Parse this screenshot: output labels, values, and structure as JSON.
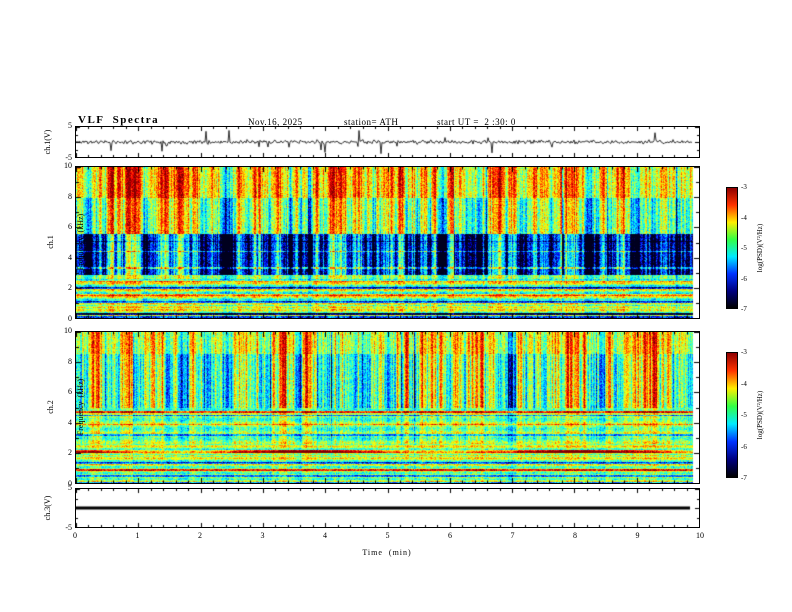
{
  "figure": {
    "title": "VLF  Spectra",
    "date": "Nov.16, 2025",
    "station_label": "station= ATH",
    "start_ut_label": "start UT =  2 :30: 0"
  },
  "axes": {
    "x_title": "Time  (min)",
    "x_ticks": [
      "0",
      "1",
      "2",
      "3",
      "4",
      "5",
      "6",
      "7",
      "8",
      "9",
      "10"
    ],
    "freq_ticks": [
      "10",
      "8",
      "6",
      "4",
      "2",
      "0"
    ],
    "volt_ticks": [
      "5",
      "-5"
    ],
    "ch1v_label": "ch.1(V)",
    "ch1_label_line1": "ch.1",
    "ch1_label_line2": "Frequency  (kHz)",
    "ch2_label_line1": "ch.2",
    "ch2_label_line2": "Frequency  (kHz)",
    "ch3v_label": "ch.3(V)"
  },
  "colorbar": {
    "ticks": [
      "-3",
      "-4",
      "-5",
      "-6",
      "-7"
    ],
    "label": "log(PSD)(V²/Hz)",
    "value_range": [
      -7,
      -3
    ],
    "colors_top_to_bottom": [
      "#8f0000",
      "#ff3300",
      "#ffee00",
      "#33ff44",
      "#00eaff",
      "#0033ff",
      "#000080",
      "#000000"
    ]
  },
  "chart_data": [
    {
      "type": "line",
      "name": "ch1-voltage-waveform",
      "ylabel": "ch.1(V)",
      "ylim": [
        -5,
        5
      ],
      "xlim": [
        0,
        10
      ],
      "xlabel": "Time (min)",
      "data_end_min": 9.9,
      "baseline_v": 0,
      "noise_amp_v": 0.45,
      "spike_probability": 0.03,
      "spike_max_v": 4.6,
      "seed": 11
    },
    {
      "type": "heatmap",
      "name": "ch1-spectrogram",
      "ylabel": "ch.1 Frequency (kHz)",
      "ylim": [
        0,
        10
      ],
      "xlim": [
        0,
        10
      ],
      "value_range": [
        -7,
        -3
      ],
      "units": "log(PSD)(V²/Hz)",
      "colormap": "jet-black-low",
      "seed": 7,
      "base_level": -5.05,
      "noise": 0.9,
      "data_end_min": 9.9,
      "regions": [
        {
          "freq": [
            8.0,
            10.01
          ],
          "delta": 0.75,
          "streak_w": 0.9
        },
        {
          "freq": [
            5.6,
            8.0
          ],
          "delta": 0.2,
          "streak_w": 1.0
        },
        {
          "freq": [
            2.9,
            5.6
          ],
          "delta": -1.25,
          "streak_w": 1.2
        },
        {
          "freq": [
            2.6,
            2.9
          ],
          "delta": 0.1,
          "streak_w": 0.5
        },
        {
          "freq": [
            0,
            2.6
          ],
          "delta": 0.15,
          "streak_w": 0.3,
          "stripe_k": 14,
          "stripe_amp": 0.55
        }
      ],
      "hlines": [
        {
          "f": 0.05,
          "d": -1.8,
          "w": 0.09
        },
        {
          "f": 0.3,
          "d": -1.7,
          "w": 0.06
        },
        {
          "f": 0.75,
          "d": 0.9,
          "w": 0.05
        },
        {
          "f": 1.1,
          "d": -1.5,
          "w": 0.06
        },
        {
          "f": 1.55,
          "d": 0.8,
          "w": 0.05
        },
        {
          "f": 2.0,
          "d": -1.5,
          "w": 0.06
        },
        {
          "f": 2.45,
          "d": 0.7,
          "w": 0.05
        },
        {
          "f": 3.35,
          "d": 1.0,
          "w": 0.05
        },
        {
          "f": 4.45,
          "d": 0.9,
          "w": 0.05
        },
        {
          "f": 5.1,
          "d": -0.6,
          "w": 0.05
        }
      ]
    },
    {
      "type": "heatmap",
      "name": "ch2-spectrogram",
      "ylabel": "ch.2 Frequency (kHz)",
      "ylim": [
        0,
        10
      ],
      "xlim": [
        0,
        10
      ],
      "value_range": [
        -7,
        -3
      ],
      "units": "log(PSD)(V²/Hz)",
      "colormap": "jet-black-low",
      "seed": 23,
      "base_level": -5.0,
      "noise": 0.85,
      "data_end_min": 9.9,
      "regions": [
        {
          "freq": [
            8.6,
            10.01
          ],
          "delta": 0.55,
          "streak_w": 0.9
        },
        {
          "freq": [
            5.0,
            8.6
          ],
          "delta": 0.15,
          "streak_w": 1.15
        },
        {
          "freq": [
            2.6,
            5.0
          ],
          "delta": 0.12,
          "streak_w": 0.45,
          "stripe_k": 10,
          "stripe_amp": 0.3
        },
        {
          "freq": [
            0,
            2.6
          ],
          "delta": 0.2,
          "streak_w": 0.25,
          "stripe_k": 16,
          "stripe_amp": 0.5
        }
      ],
      "hlines": [
        {
          "f": 0.05,
          "d": -1.5,
          "w": 0.08
        },
        {
          "f": 0.5,
          "d": -1.6,
          "w": 0.06
        },
        {
          "f": 0.9,
          "d": 0.9,
          "w": 0.05
        },
        {
          "f": 1.35,
          "d": -1.4,
          "w": 0.05
        },
        {
          "f": 1.85,
          "d": 0.8,
          "w": 0.05
        },
        {
          "f": 2.15,
          "d": 1.9,
          "w": 0.1,
          "seg": true
        },
        {
          "f": 3.2,
          "d": -1.1,
          "w": 0.05
        },
        {
          "f": 3.9,
          "d": 0.7,
          "w": 0.04
        },
        {
          "f": 4.5,
          "d": -1.3,
          "w": 0.05
        },
        {
          "f": 4.75,
          "d": 1.5,
          "w": 0.06
        }
      ]
    },
    {
      "type": "line",
      "name": "ch3-voltage-waveform",
      "ylabel": "ch.3(V)",
      "ylim": [
        -5,
        5
      ],
      "xlim": [
        0,
        10
      ],
      "data_end_min": 9.85,
      "baseline_v": 0,
      "noise_amp_v": 0,
      "spike_probability": 0,
      "spike_max_v": 0,
      "line_width": 3,
      "seed": 3
    }
  ]
}
